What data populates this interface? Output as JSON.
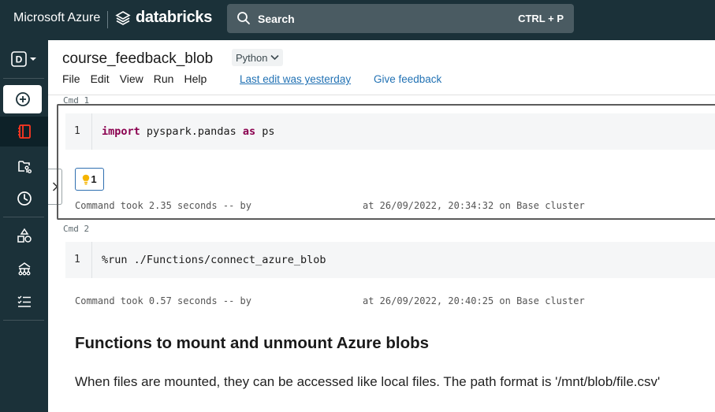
{
  "header": {
    "brand_ms": "Microsoft Azure",
    "brand_db": "databricks",
    "search_label": "Search",
    "search_shortcut": "CTRL + P"
  },
  "sidebar": {
    "workspace_letter": "D",
    "items": [
      {
        "icon": "plus-circle-icon"
      },
      {
        "icon": "notebook-icon",
        "active": true
      },
      {
        "icon": "repos-icon"
      },
      {
        "icon": "clock-icon"
      },
      {
        "icon": "shapes-icon"
      },
      {
        "icon": "hierarchy-icon"
      },
      {
        "icon": "list-check-icon"
      }
    ]
  },
  "notebook": {
    "title": "course_feedback_blob",
    "language": "Python",
    "menu": [
      "File",
      "Edit",
      "View",
      "Run",
      "Help"
    ],
    "last_edit": "Last edit was yesterday",
    "feedback": "Give feedback"
  },
  "cells": [
    {
      "label": "Cmd 1",
      "line_no": "1",
      "code_kw1": "import",
      "code_mid": " pyspark.pandas ",
      "code_kw2": "as",
      "code_end": " ps",
      "bulb_count": "1",
      "took": "Command took 2.35 seconds -- by",
      "at": "at 26/09/2022, 20:34:32 on Base cluster"
    },
    {
      "label": "Cmd 2",
      "line_no": "1",
      "code": "%run ./Functions/connect_azure_blob",
      "took": "Command took 0.57 seconds -- by",
      "at": "at 26/09/2022, 20:40:25 on Base cluster"
    }
  ],
  "markdown": {
    "heading": "Functions to mount and unmount Azure blobs",
    "text": "When files are mounted, they can be accessed like local files. The path format is '/mnt/blob/file.csv'"
  },
  "colors": {
    "topbar": "#1b3139",
    "accent_red": "#ff3621",
    "link": "#2272b4"
  }
}
